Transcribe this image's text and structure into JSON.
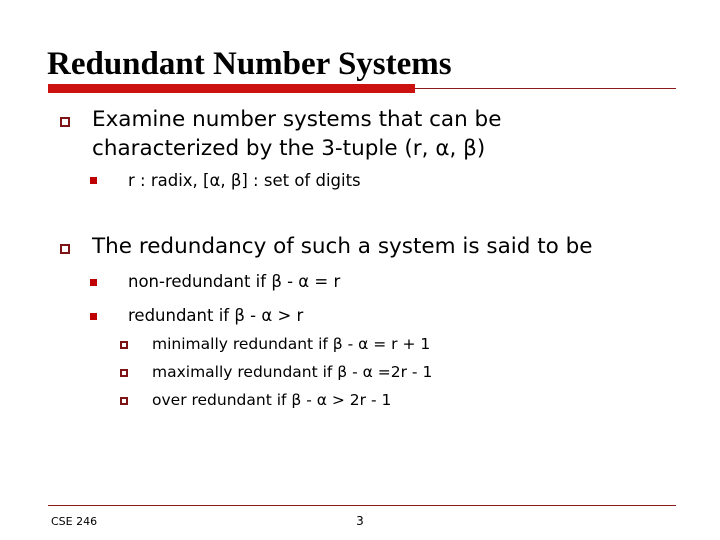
{
  "slide": {
    "title": "Redundant Number Systems",
    "accent_color": "#cc1111",
    "rule_color": "#8b1a1a",
    "bullet_hollow_color": "#7e1416",
    "bullet_solid_color": "#c00000",
    "background": "#ffffff"
  },
  "content": {
    "bullet1": {
      "marker": "hollow-square-bullet",
      "line1": "Examine number systems that can be",
      "line2": "characterized by the 3-tuple (r, α, β)",
      "sub": [
        {
          "marker": "solid-square-bullet",
          "text": "r : radix, [α, β] : set of digits"
        }
      ]
    },
    "bullet2": {
      "marker": "hollow-square-bullet",
      "line1": "The redundancy of such a system is said to be",
      "sub": [
        {
          "marker": "solid-square-bullet",
          "text": "non-redundant if β - α = r"
        },
        {
          "marker": "solid-square-bullet",
          "text": "redundant if β - α > r",
          "sub": [
            {
              "marker": "hollow-square-bullet",
              "text": "minimally redundant if β - α = r + 1"
            },
            {
              "marker": "hollow-square-bullet",
              "text": "maximally redundant if β - α =2r - 1"
            },
            {
              "marker": "hollow-square-bullet",
              "text": "over redundant if β - α > 2r - 1"
            }
          ]
        }
      ]
    }
  },
  "footer": {
    "course": "CSE 246",
    "page_number": "3"
  }
}
